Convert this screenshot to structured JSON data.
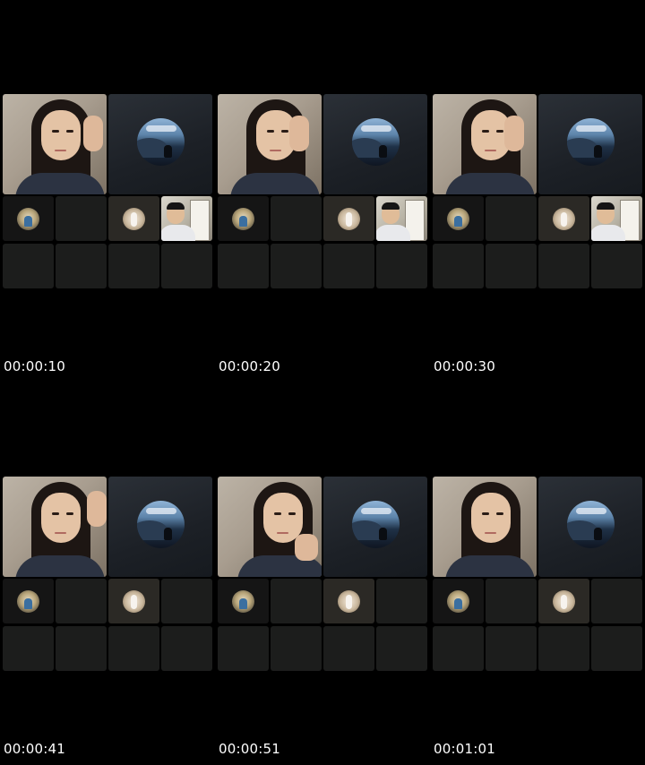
{
  "timestamps": [
    "00:00:10",
    "00:00:20",
    "00:00:30",
    "00:00:41",
    "00:00:51",
    "00:01:01"
  ],
  "icons": {
    "participant_video": "participant-video-icon",
    "landscape_avatar": "landscape-avatar-icon",
    "profile_avatar": "profile-avatar-icon"
  },
  "colors": {
    "background": "#000000",
    "tile": "#1c1d1c",
    "timestamp_text": "#ffffff"
  }
}
